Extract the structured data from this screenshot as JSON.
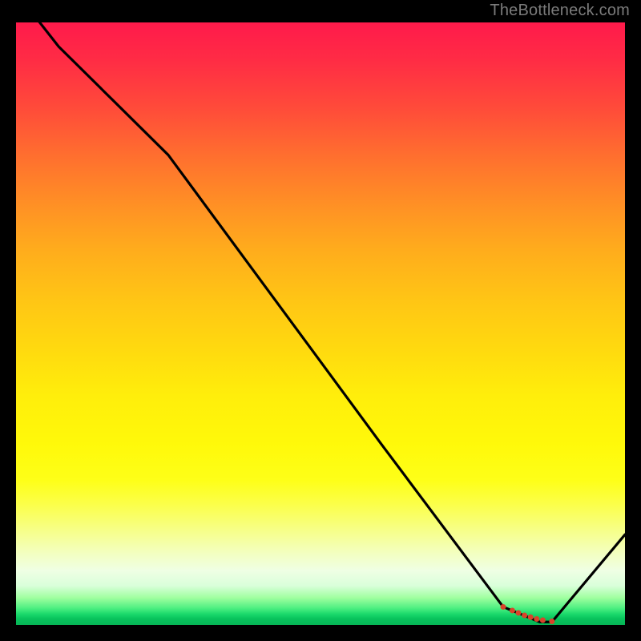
{
  "watermark": "TheBottleneck.com",
  "colors": {
    "line": "#000000",
    "marker": "#d9432a",
    "marker_label": "#e04a2f",
    "gradient_top": "#ff1a4b",
    "gradient_bottom": "#06b556"
  },
  "chart_data": {
    "type": "line",
    "title": "",
    "xlabel": "",
    "ylabel": "",
    "xlim": [
      0,
      100
    ],
    "ylim": [
      0,
      100
    ],
    "grid": false,
    "legend": false,
    "x": [
      0,
      7,
      25,
      60,
      80,
      86,
      88,
      100
    ],
    "values": [
      105,
      96,
      78,
      30,
      3,
      0.5,
      0.5,
      15
    ],
    "marker_points": [
      {
        "x": 80.0,
        "y": 3.0
      },
      {
        "x": 81.5,
        "y": 2.4
      },
      {
        "x": 82.5,
        "y": 2.0
      },
      {
        "x": 83.5,
        "y": 1.6
      },
      {
        "x": 84.5,
        "y": 1.3
      },
      {
        "x": 85.5,
        "y": 1.0
      },
      {
        "x": 86.5,
        "y": 0.8
      },
      {
        "x": 88.0,
        "y": 0.6
      }
    ],
    "marker_label": ""
  }
}
